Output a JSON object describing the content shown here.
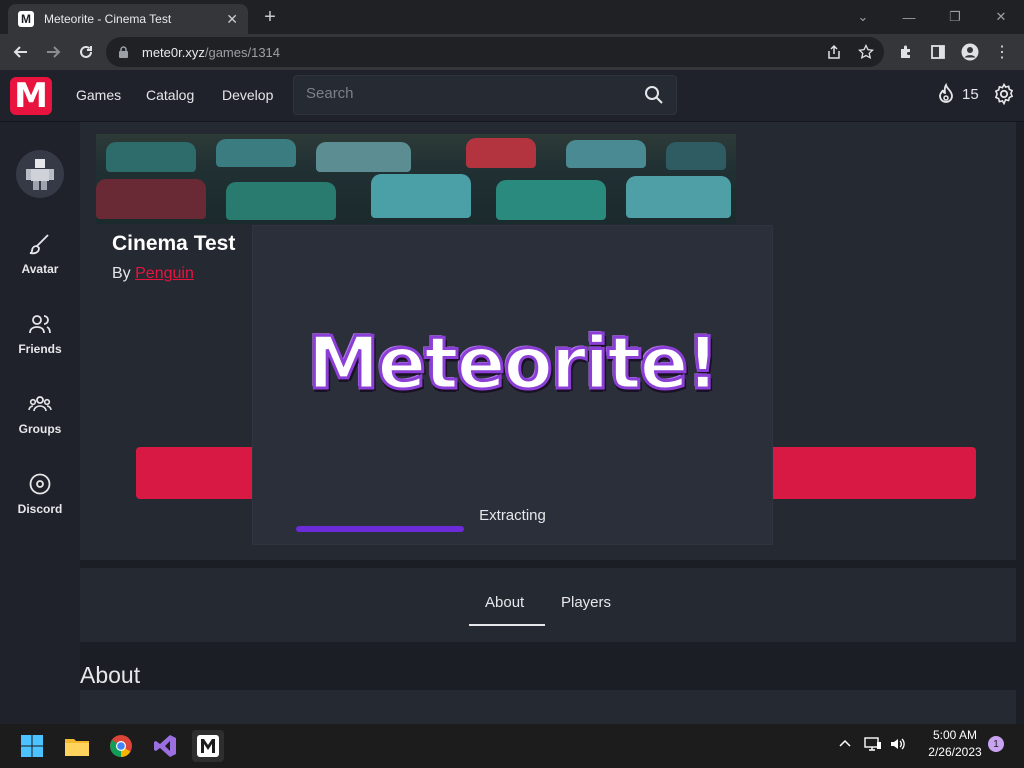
{
  "browser": {
    "tab_title": "Meteorite - Cinema Test",
    "favicon_letter": "M",
    "url_host": "mete0r.xyz",
    "url_path": "/games/1314"
  },
  "header": {
    "logo_letter": "M",
    "nav": [
      "Games",
      "Catalog",
      "Develop"
    ],
    "search_placeholder": "Search",
    "currency_count": "15"
  },
  "sidebar": {
    "items": [
      {
        "label": "Avatar",
        "icon": "brush-icon"
      },
      {
        "label": "Friends",
        "icon": "friends-icon"
      },
      {
        "label": "Groups",
        "icon": "groups-icon"
      },
      {
        "label": "Discord",
        "icon": "discord-icon"
      }
    ]
  },
  "game": {
    "title": "Cinema Test",
    "by_prefix": "By",
    "creator": "Penguin"
  },
  "tabs": [
    "About",
    "Players"
  ],
  "about_heading": "About",
  "loader": {
    "title": "Meteorite!",
    "status": "Extracting",
    "progress": 0.385
  },
  "taskbar": {
    "time": "5:00 AM",
    "date": "2/26/2023",
    "notification_count": "1"
  },
  "colors": {
    "accent": "#e8143f",
    "play_button": "#d81943",
    "progress": "#6c2bd9"
  }
}
